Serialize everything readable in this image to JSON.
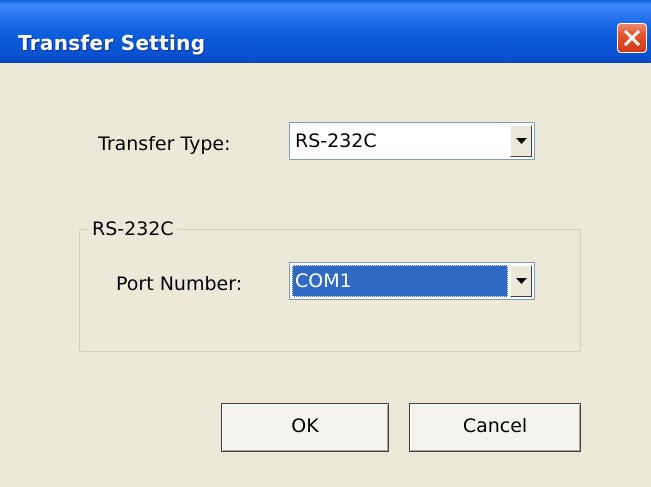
{
  "window": {
    "title": "Transfer Setting",
    "close_icon": "close-icon"
  },
  "transfer": {
    "label": "Transfer Type:",
    "value": "RS-232C"
  },
  "group": {
    "title": "RS-232C",
    "port_label": "Port Number:",
    "port_value": "COM1"
  },
  "buttons": {
    "ok": "OK",
    "cancel": "Cancel"
  },
  "colors": {
    "titlebar": "#0A55D6",
    "close": "#E0522D",
    "selection": "#316AC5",
    "face": "#ECE9D8"
  }
}
